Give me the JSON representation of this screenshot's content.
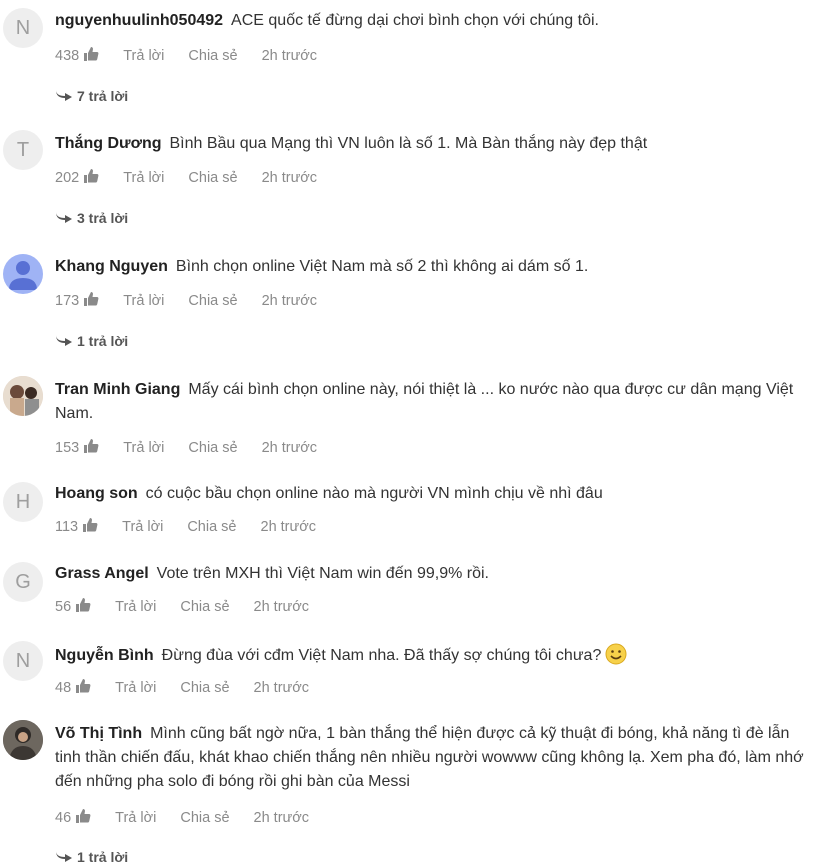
{
  "comments": [
    {
      "initial": "N",
      "author": "nguyenhuulinh050492",
      "text": "ACE quốc tế đừng dại chơi bình chọn với chúng tôi.",
      "likes": "438",
      "reply": "Trả lời",
      "share": "Chia sẻ",
      "time": "2h trước",
      "replies": "7 trả lời"
    },
    {
      "initial": "T",
      "author": "Thắng Dương",
      "text": "Bình Bầu qua Mạng thì VN luôn là số 1. Mà Bàn thắng này đẹp thật",
      "likes": "202",
      "reply": "Trả lời",
      "share": "Chia sẻ",
      "time": "2h trước",
      "replies": "3 trả lời"
    },
    {
      "initial": "",
      "author": "Khang Nguyen",
      "text": "Bình chọn online Việt Nam mà số 2 thì không ai dám số 1.",
      "likes": "173",
      "reply": "Trả lời",
      "share": "Chia sẻ",
      "time": "2h trước",
      "replies": "1 trả lời"
    },
    {
      "initial": "",
      "author": "Tran Minh Giang",
      "text": "Mấy cái bình chọn online này, nói thiệt là ... ko nước nào qua được cư dân mạng Việt Nam.",
      "likes": "153",
      "reply": "Trả lời",
      "share": "Chia sẻ",
      "time": "2h trước"
    },
    {
      "initial": "H",
      "author": "Hoang son",
      "text": "có cuộc bầu chọn online nào mà người VN mình chịu về nhì đâu",
      "likes": "113",
      "reply": "Trả lời",
      "share": "Chia sẻ",
      "time": "2h trước"
    },
    {
      "initial": "G",
      "author": "Grass Angel",
      "text": "Vote trên MXH thì Việt Nam win đến 99,9% rồi.",
      "likes": "56",
      "reply": "Trả lời",
      "share": "Chia sẻ",
      "time": "2h trước"
    },
    {
      "initial": "N",
      "author": "Nguyễn Bình",
      "text": "Đừng đùa với cđm Việt Nam nha. Đã thấy sợ chúng tôi chưa?",
      "likes": "48",
      "reply": "Trả lời",
      "share": "Chia sẻ",
      "time": "2h trước"
    },
    {
      "initial": "",
      "author": "Võ Thị Tình",
      "text": "Mình cũng bất ngờ nữa, 1 bàn thắng thể hiện được cả kỹ thuật đi bóng, khả năng tì đè lẫn tinh thần chiến đấu, khát khao chiến thắng nên nhiều người wowww cũng không lạ. Xem pha đó, làm nhớ đến những pha solo đi bóng rồi ghi bàn của Messi",
      "likes": "46",
      "reply": "Trả lời",
      "share": "Chia sẻ",
      "time": "2h trước",
      "replies": "1 trả lời"
    }
  ],
  "icons": {
    "like": "thumbs-up-icon",
    "reply_arrow": "reply-arrow-icon",
    "emoji": "smiling-face-icon"
  },
  "colors": {
    "avatar_bg": "#eeeeee",
    "default_avatar": "#9fb3f5",
    "muted_text": "#8a8a8a"
  }
}
